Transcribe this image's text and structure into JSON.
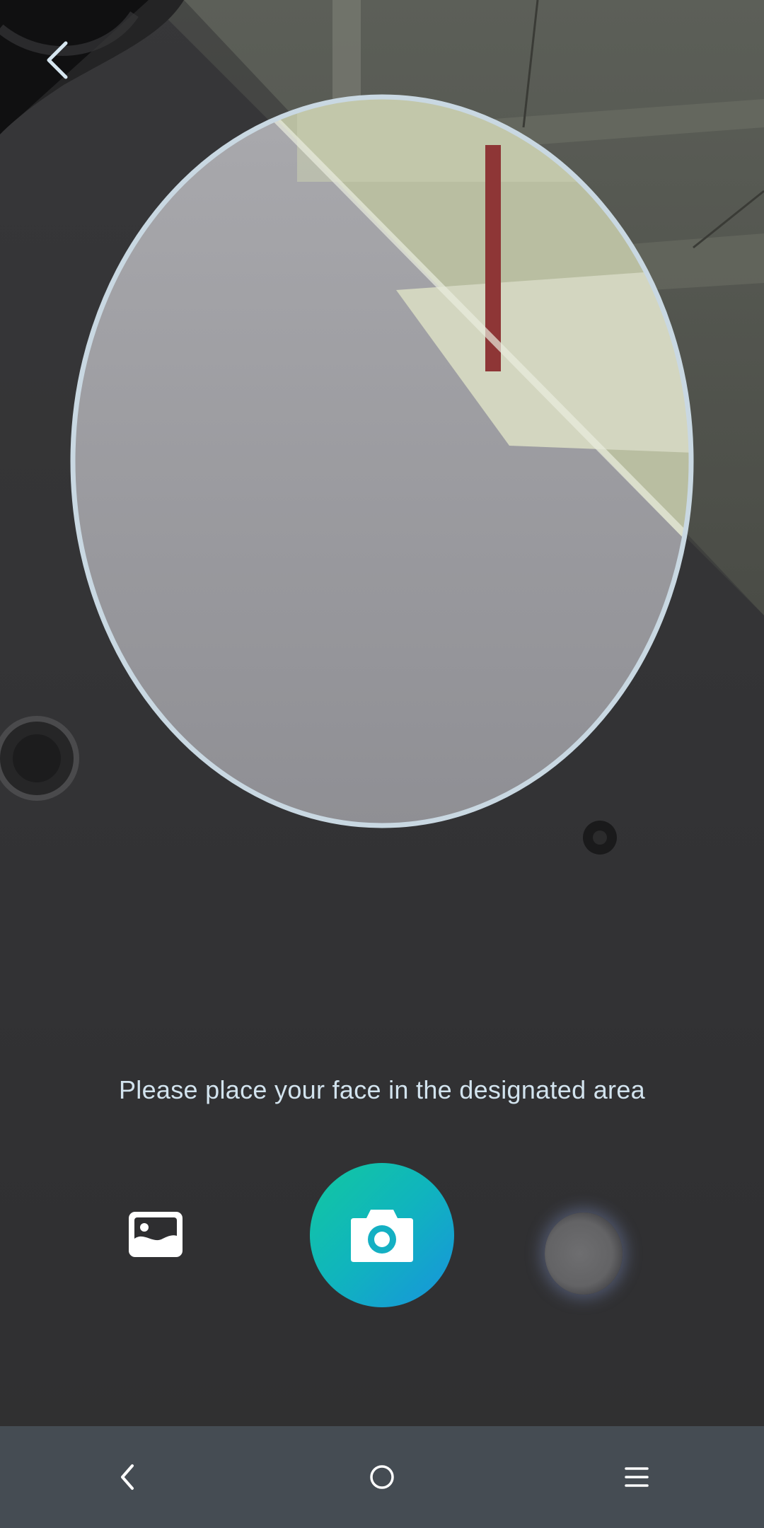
{
  "capture": {
    "hint": "Please place your face in the designated area"
  },
  "icons": {
    "back": "chevron-left-icon",
    "gallery": "image-icon",
    "shutter": "camera-icon",
    "flip": "switch-camera-icon",
    "nav_back": "nav-back-icon",
    "nav_home": "nav-home-icon",
    "nav_menu": "nav-menu-icon"
  },
  "colors": {
    "frame_outline": "#c9d8e2",
    "hint_text": "#d2e3ee",
    "shutter_gradient_start": "#12c8a0",
    "shutter_gradient_end": "#1893dd",
    "navbar_bg": "#454c53"
  }
}
